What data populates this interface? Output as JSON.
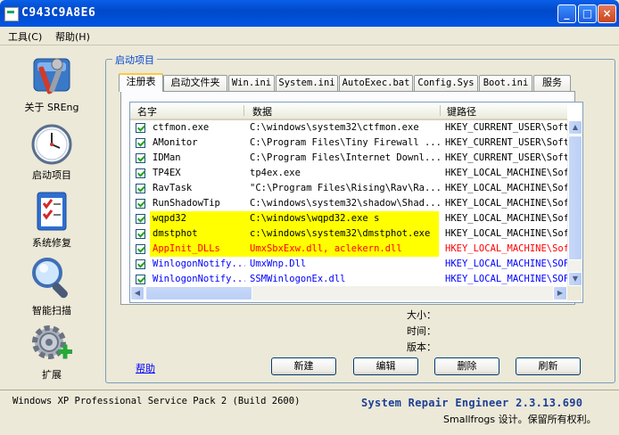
{
  "window": {
    "title": "C943C9A8E6",
    "minimize": "_",
    "maximize": "□",
    "close": "×"
  },
  "menu": [
    {
      "label": "工具(C)"
    },
    {
      "label": "帮助(H)"
    }
  ],
  "sidebar": [
    {
      "label": "关于 SREng",
      "icon": "tools-icon"
    },
    {
      "label": "启动项目",
      "icon": "clock-icon"
    },
    {
      "label": "系统修复",
      "icon": "checklist-icon"
    },
    {
      "label": "智能扫描",
      "icon": "magnifier-icon"
    },
    {
      "label": "扩展",
      "icon": "gear-plus-icon"
    }
  ],
  "group_title": "启动项目",
  "tabs": [
    "注册表",
    "启动文件夹",
    "Win.ini",
    "System.ini",
    "AutoExec.bat",
    "Config.Sys",
    "Boot.ini",
    "服务"
  ],
  "columns": [
    "名字",
    "数据",
    "键路径"
  ],
  "rows": [
    {
      "name": "ctfmon.exe",
      "data": "C:\\windows\\system32\\ctfmon.exe",
      "path": "HKEY_CURRENT_USER\\Softw",
      "highlight": "",
      "color": "#000000"
    },
    {
      "name": "AMonitor",
      "data": "C:\\Program Files\\Tiny Firewall ...",
      "path": "HKEY_CURRENT_USER\\Softw",
      "highlight": "",
      "color": "#000000"
    },
    {
      "name": "IDMan",
      "data": "C:\\Program Files\\Internet Downl...",
      "path": "HKEY_CURRENT_USER\\Softw",
      "highlight": "",
      "color": "#000000"
    },
    {
      "name": "TP4EX",
      "data": "tp4ex.exe",
      "path": "HKEY_LOCAL_MACHINE\\Soft",
      "highlight": "",
      "color": "#000000"
    },
    {
      "name": "RavTask",
      "data": "\"C:\\Program Files\\Rising\\Rav\\Ra...",
      "path": "HKEY_LOCAL_MACHINE\\Soft",
      "highlight": "",
      "color": "#000000"
    },
    {
      "name": "RunShadowTip",
      "data": "C:\\windows\\system32\\shadow\\Shad...",
      "path": "HKEY_LOCAL_MACHINE\\Soft",
      "highlight": "",
      "color": "#000000"
    },
    {
      "name": "wqpd32",
      "data": "C:\\windows\\wqpd32.exe s",
      "path": "HKEY_LOCAL_MACHINE\\Soft",
      "highlight": "#ffff00",
      "color": "#000000"
    },
    {
      "name": "dmstphot",
      "data": "c:\\windows\\system32\\dmstphot.exe",
      "path": "HKEY_LOCAL_MACHINE\\Soft",
      "highlight": "#ffff00",
      "color": "#000000"
    },
    {
      "name": "AppInit_DLLs",
      "data": "UmxSbxExw.dll, aclekern.dll",
      "path": "HKEY_LOCAL_MACHINE\\Soft",
      "highlight": "#ffff00",
      "color": "#ff0000"
    },
    {
      "name": "WinlogonNotify...",
      "data": "UmxWnp.Dll",
      "path": "HKEY_LOCAL_MACHINE\\SOFT",
      "highlight": "",
      "color": "#0000ff"
    },
    {
      "name": "WinlogonNotify...",
      "data": "SSMWinlogonEx.dll",
      "path": "HKEY_LOCAL_MACHINE\\SOFT",
      "highlight": "",
      "color": "#0000ff"
    }
  ],
  "info": {
    "size_label": "大小：",
    "time_label": "时间：",
    "version_label": "版本："
  },
  "help_link": "帮助",
  "buttons": {
    "new": "新建",
    "edit": "编辑",
    "delete": "删除",
    "refresh": "刷新"
  },
  "status": {
    "os": "Windows XP Professional Service Pack 2 (Build 2600)",
    "product": "System Repair Engineer 2.3.13.690",
    "copyright": "Smallfrogs 设计。保留所有权利。"
  }
}
